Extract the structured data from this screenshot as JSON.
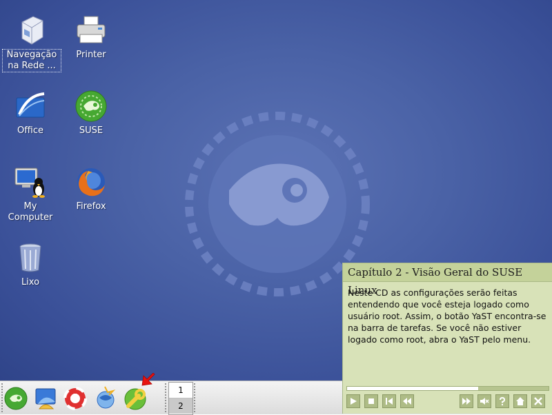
{
  "desktop": {
    "icons": [
      {
        "id": "network",
        "label": "Navegação na Rede ...",
        "icon": "network-browse-icon"
      },
      {
        "id": "printer",
        "label": "Printer",
        "icon": "printer-icon"
      },
      {
        "id": "office",
        "label": "Office",
        "icon": "office-icon"
      },
      {
        "id": "suse",
        "label": "SUSE",
        "icon": "suse-icon"
      },
      {
        "id": "mycomputer",
        "label": "My Computer",
        "icon": "my-computer-icon"
      },
      {
        "id": "firefox",
        "label": "Firefox",
        "icon": "firefox-icon"
      },
      {
        "id": "trash",
        "label": "Lixo",
        "icon": "trash-icon"
      }
    ]
  },
  "taskbar": {
    "buttons": [
      "suse-menu-icon",
      "desktop-icon",
      "help-icon",
      "konqueror-icon",
      "yast-icon"
    ],
    "pager": {
      "desktops": [
        "1",
        "2"
      ],
      "active": 0
    }
  },
  "tutorial": {
    "title": "Capítulo 2 - Visão Geral do SUSE Linux",
    "body": "Neste CD as configurações serão feitas entendendo que você esteja logado como usuário root. Assim, o botão YaST encontra-se na barra de tarefas. Se você não estiver logado como root, abra o YaST pelo menu.",
    "progress": 0.65,
    "controls": [
      "play-icon",
      "stop-icon",
      "first-icon",
      "rewind-icon",
      "fast-forward-icon",
      "mute-icon",
      "help-question-icon",
      "home-icon",
      "close-icon"
    ]
  },
  "colors": {
    "desktop_bg": "#4a62a6",
    "panel_bg": "#d8e2b8",
    "panel_title_bg": "#c4d29a",
    "arrow": "#e8140f"
  }
}
